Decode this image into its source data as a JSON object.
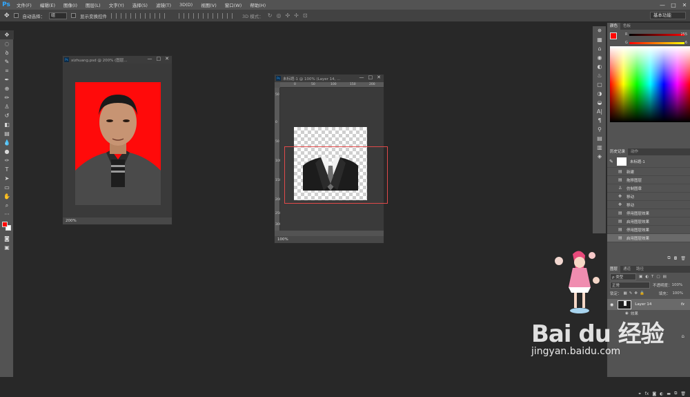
{
  "app": {
    "logo": "Ps",
    "menu": [
      "文件(F)",
      "编辑(E)",
      "图像(I)",
      "图层(L)",
      "文字(Y)",
      "选择(S)",
      "滤镜(T)",
      "3D(D)",
      "视图(V)",
      "窗口(W)",
      "帮助(H)"
    ],
    "window_controls": [
      "—",
      "□",
      "✕"
    ]
  },
  "options_bar": {
    "auto_select_label": "自动选择：",
    "auto_select_value": "组",
    "show_transform_label": "显示变换控件",
    "mode_label": "3D 模式：",
    "workspace": "基本功能"
  },
  "documents": [
    {
      "title": "xizhuang.psd @ 200% (图层...",
      "zoom": "200%"
    },
    {
      "title": "未标题-1 @ 100% (Layer 14, ...",
      "zoom": "100%"
    }
  ],
  "rulers": {
    "h": [
      "0",
      "50",
      "100",
      "150",
      "200"
    ],
    "v": [
      "50",
      "0",
      "50",
      "100",
      "150",
      "200",
      "250",
      "300"
    ]
  },
  "color_panel": {
    "tabs": [
      "颜色",
      "色板"
    ],
    "r_label": "R",
    "r_value": "255",
    "g_label": "G",
    "g_value": "6",
    "b_label": "B",
    "b_value": "0",
    "fg_color": "#ff0600",
    "bg_color": "#ffffff"
  },
  "history_panel": {
    "tabs": [
      "历史记录",
      "动作"
    ],
    "snapshot": "未标题-1",
    "items": [
      "新建",
      "拖移图层",
      "仿制图章",
      "移动",
      "移动",
      "停用图层效果",
      "启用图层效果",
      "停用图层效果",
      "启用图层效果"
    ]
  },
  "layers_panel": {
    "tabs": [
      "图层",
      "通道",
      "路径"
    ],
    "kind_label": "ρ 类型",
    "blend_mode": "正常",
    "opacity_label": "不透明度：",
    "opacity_value": "100%",
    "lock_label": "锁定：",
    "fill_label": "填充：",
    "fill_value": "100%",
    "layer_name": "Layer 14",
    "fx_label": "fx",
    "effects_label": "效果"
  },
  "watermark": {
    "logo": "Bai du 经验",
    "url": "jingyan.baidu.com"
  }
}
